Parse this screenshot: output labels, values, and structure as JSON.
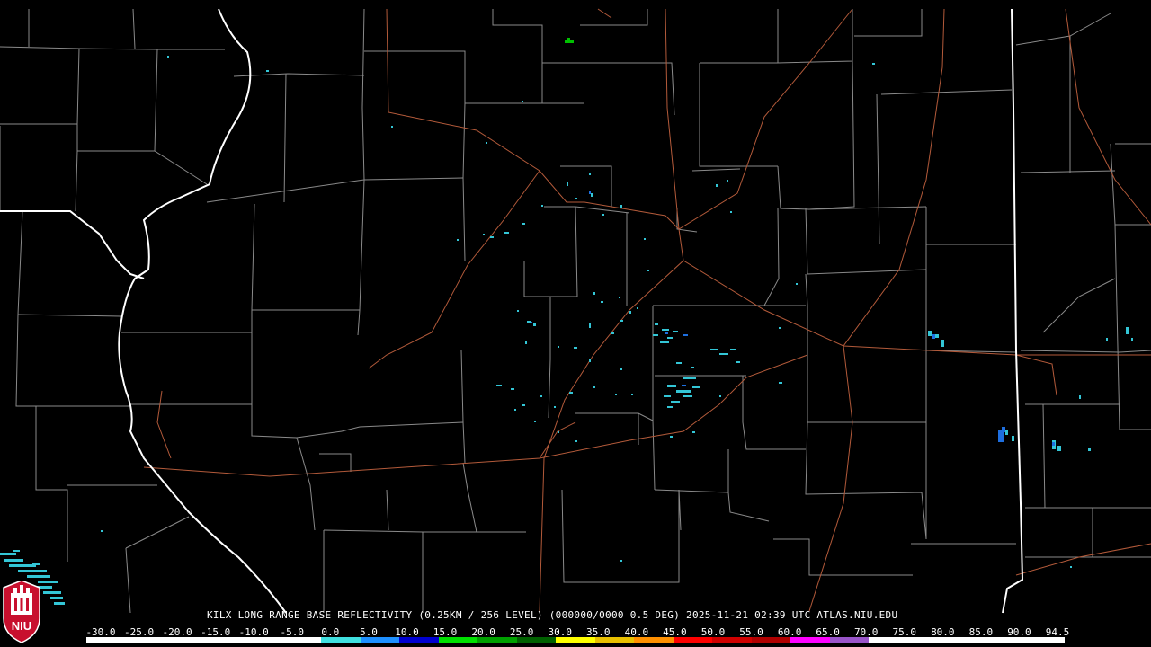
{
  "caption": "KILX LONG RANGE BASE REFLECTIVITY (0.25KM / 256 LEVEL) (000000/0000 0.5 DEG) 2025-11-21 02:39 UTC  ATLAS.NIU.EDU",
  "logo": {
    "text": "NIU",
    "icon": "niu-logo-icon",
    "color": "#c8102e"
  },
  "scale": {
    "labels": [
      "-30.0",
      "-25.0",
      "-20.0",
      "-15.0",
      "-10.0",
      "-5.0",
      "0.0",
      "5.0",
      "10.0",
      "15.0",
      "20.0",
      "25.0",
      "30.0",
      "35.0",
      "40.0",
      "45.0",
      "50.0",
      "55.0",
      "60.0",
      "65.0",
      "70.0",
      "75.0",
      "80.0",
      "85.0",
      "90.0",
      "94.5"
    ],
    "colors": [
      "#000000",
      "#000000",
      "#000000",
      "#000000",
      "#000000",
      "#000000",
      "#40e0e0",
      "#1e90ff",
      "#0000d0",
      "#00e000",
      "#00a000",
      "#006000",
      "#ffff00",
      "#e8c000",
      "#ff9000",
      "#ff0000",
      "#d00000",
      "#b00000",
      "#ff00ff",
      "#9955c9",
      "#ffffff",
      "#ffffff",
      "#ffffff",
      "#ffffff",
      "#ffffff"
    ]
  },
  "colors": {
    "state_border": "#ffffff",
    "county_lines": "#8a8a8a",
    "highways": "#b35a3a",
    "echo_light": "#33c6d6",
    "echo_medium": "#1e6fe0",
    "echo_strong": "#00c000"
  }
}
